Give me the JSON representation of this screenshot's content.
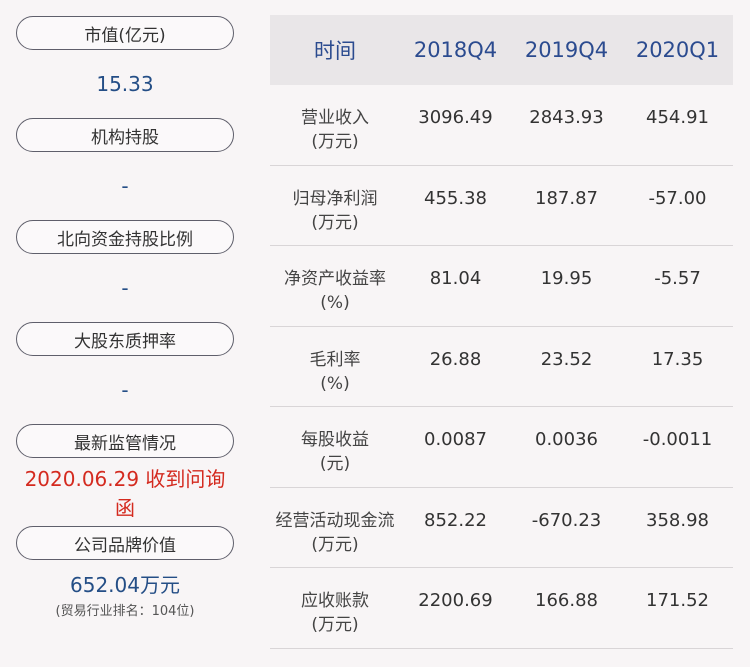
{
  "left": {
    "items": [
      {
        "label": "市值(亿元)",
        "value": "15.33"
      },
      {
        "label": "机构持股",
        "value": "-"
      },
      {
        "label": "北向资金持股比例",
        "value": "-"
      },
      {
        "label": "大股东质押率",
        "value": "-"
      },
      {
        "label": "最新监管情况",
        "value": "2020.06.29 收到问询函"
      },
      {
        "label": "公司品牌价值",
        "value": "652.04万元",
        "sub": "(贸易行业排名：104位)"
      }
    ]
  },
  "table": {
    "headers": [
      "时间",
      "2018Q4",
      "2019Q4",
      "2020Q1"
    ],
    "rows": [
      {
        "name": "营业收入",
        "unit": "(万元)",
        "values": [
          "3096.49",
          "2843.93",
          "454.91"
        ]
      },
      {
        "name": "归母净利润",
        "unit": "(万元)",
        "values": [
          "455.38",
          "187.87",
          "-57.00"
        ]
      },
      {
        "name": "净资产收益率",
        "unit": "(%)",
        "values": [
          "81.04",
          "19.95",
          "-5.57"
        ]
      },
      {
        "name": "毛利率",
        "unit": "(%)",
        "values": [
          "26.88",
          "23.52",
          "17.35"
        ]
      },
      {
        "name": "每股收益",
        "unit": "(元)",
        "values": [
          "0.0087",
          "0.0036",
          "-0.0011"
        ]
      },
      {
        "name": "经营活动现金流",
        "unit": "(万元)",
        "values": [
          "852.22",
          "-670.23",
          "358.98"
        ]
      },
      {
        "name": "应收账款",
        "unit": "(万元)",
        "values": [
          "2200.69",
          "166.88",
          "171.52"
        ]
      }
    ]
  }
}
